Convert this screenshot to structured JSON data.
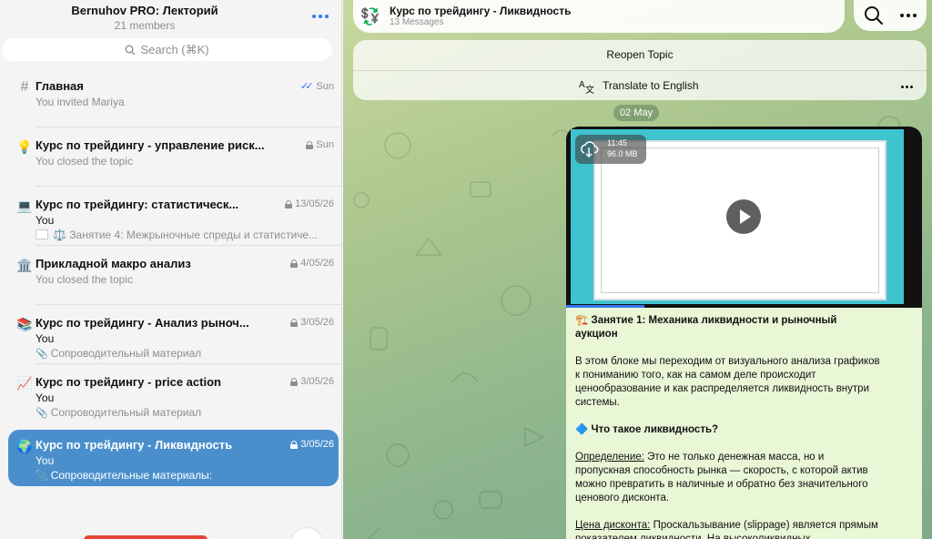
{
  "group": {
    "title": "Bernuhov PRO: Лекторий",
    "members": "21 members"
  },
  "search": {
    "placeholder": "Search (⌘K)"
  },
  "topics": [
    {
      "icon": "#",
      "title": "Главная",
      "date": "Sun",
      "line2": "You invited Mariya",
      "line3": "",
      "status": "read"
    },
    {
      "icon": "💡",
      "title": "Курс по трейдингу - управление риск...",
      "date": "Sun",
      "line2": "You closed the topic",
      "line3": "",
      "status": "locked"
    },
    {
      "icon": "💻",
      "title": "Курс по трейдингу: статистическ...",
      "date": "13/05/26",
      "line2": "You",
      "line3": "⚖️ Занятие 4: Межрыночные спреды и статистиче...",
      "status": "locked"
    },
    {
      "icon": "🏛️",
      "title": "Прикладной макро анализ",
      "date": "4/05/26",
      "line2": "You closed the topic",
      "line3": "",
      "status": "locked"
    },
    {
      "icon": "📚",
      "title": "Курс по трейдингу - Анализ рыноч...",
      "date": "3/05/26",
      "line2": "You",
      "line3": "Сопроводительный материал",
      "status": "locked"
    },
    {
      "icon": "📈",
      "title": "Курс по трейдингу - price action",
      "date": "3/05/26",
      "line2": "You",
      "line3": "Сопроводительный материал",
      "status": "locked"
    },
    {
      "icon": "🌍",
      "title": "Курс по трейдингу - Ликвидность",
      "date": "3/05/26",
      "line2": "You",
      "line3": "Сопроводительные материалы:",
      "status": "locked"
    }
  ],
  "chat": {
    "avatar": "💱",
    "title": "Курс по трейдингу - Ликвидность",
    "subtitle": "13 Messages",
    "reopen_label": "Reopen Topic",
    "translate_label": "Translate to English",
    "date_badge": "02 May"
  },
  "video": {
    "duration": "11:45",
    "size": "96.0 MB",
    "progress_fraction": 0.22
  },
  "message": {
    "heading": "🏗️ Занятие 1: Механика ликвидности и рыночный аукцион",
    "intro": "В этом блоке мы переходим от визуального анализа графиков к пониманию того, как на самом деле происходит ценообразование и как распределяется ликвидность внутри системы.",
    "q_title": "🔷 Что такое ликвидность?",
    "def_label": "Определение:",
    "def_text": " Это не только денежная масса, но и пропускная способность рынка — скорость, с которой актив можно превратить в наличные и обратно без значительного ценового дисконта.",
    "disc_label": "Цена дисконта:",
    "disc_text": " Проскальзывание (slippage) является прямым показателем ликвидности. На высоколиквидных"
  },
  "colors": {
    "accent": "#3478f6",
    "selected_topic": "#4a8fcc",
    "message_bubble": "#e9f7d7",
    "chat_bg": "#a9c58d"
  }
}
